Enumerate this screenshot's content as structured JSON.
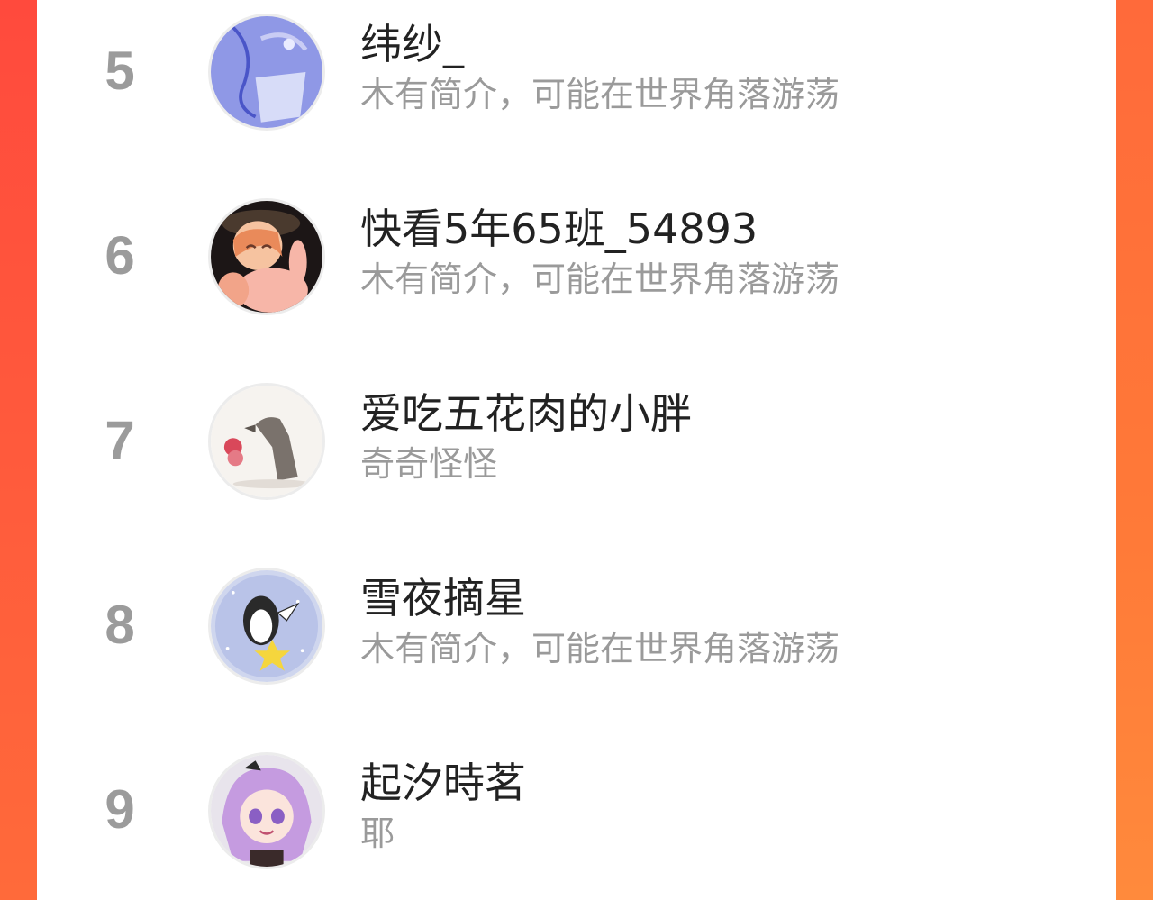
{
  "ranking": {
    "items": [
      {
        "rank": "5",
        "name": "纬纱_",
        "bio": "木有简介，可能在世界角落游荡",
        "avatar_icon": "anime-girl-ribbon-avatar"
      },
      {
        "rank": "6",
        "name": "快看5年65班_54893",
        "bio": "木有简介，可能在世界角落游荡",
        "avatar_icon": "anime-girl-bunny-avatar"
      },
      {
        "rank": "7",
        "name": "爱吃五花肉的小胖",
        "bio": "奇奇怪怪",
        "avatar_icon": "wolf-and-girl-avatar"
      },
      {
        "rank": "8",
        "name": "雪夜摘星",
        "bio": "木有简介，可能在世界角落游荡",
        "avatar_icon": "penguin-star-avatar"
      },
      {
        "rank": "9",
        "name": "起汐時茗",
        "bio": "耶",
        "avatar_icon": "purple-hair-anime-avatar"
      }
    ]
  },
  "colors": {
    "background_left": "#ff4a3d",
    "background_right": "#ff7a38",
    "panel": "#ffffff",
    "rank_text": "#9b9b9b",
    "name_text": "#222222",
    "bio_text": "#9a9a9a"
  }
}
